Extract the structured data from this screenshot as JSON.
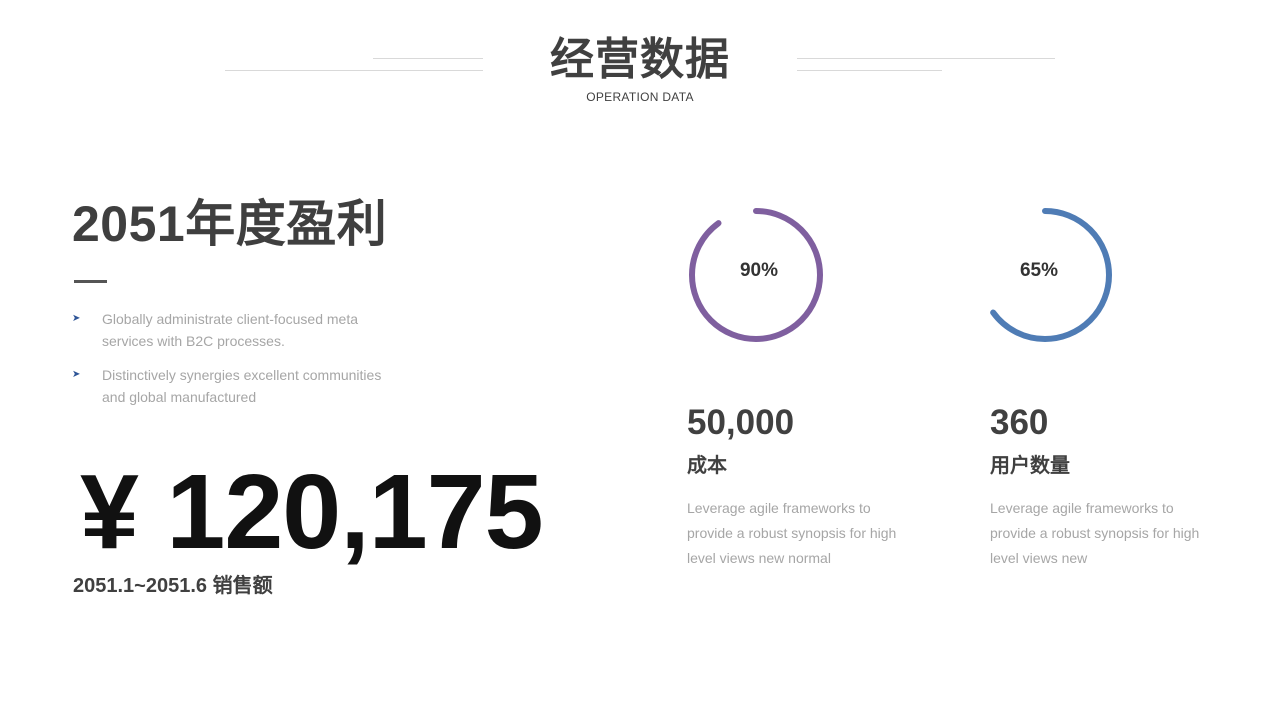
{
  "header": {
    "title": "经营数据",
    "subtitle": "OPERATION DATA"
  },
  "left": {
    "heading": "2051年度盈利",
    "bullets": [
      {
        "icon": "arrow-bullet-icon",
        "text": "Globally administrate client-focused meta services with B2C processes."
      },
      {
        "icon": "arrow-bullet-icon",
        "text": "Distinctively synergies excellent communities and global manufactured"
      }
    ],
    "big_number": "¥ 120,175",
    "period_label": "2051.1~2051.6 销售额"
  },
  "stats": [
    {
      "percent_label": "90%",
      "percent": 90,
      "color": "#7f5f9f",
      "value": "50,000",
      "label": "成本",
      "description": "Leverage agile frameworks to provide a robust synopsis for high level views  new normal"
    },
    {
      "percent_label": "65%",
      "percent": 65,
      "color": "#4f7cb5",
      "value": "360",
      "label": "用户数量",
      "description": "Leverage agile frameworks to provide a robust synopsis for high level views  new"
    }
  ]
}
